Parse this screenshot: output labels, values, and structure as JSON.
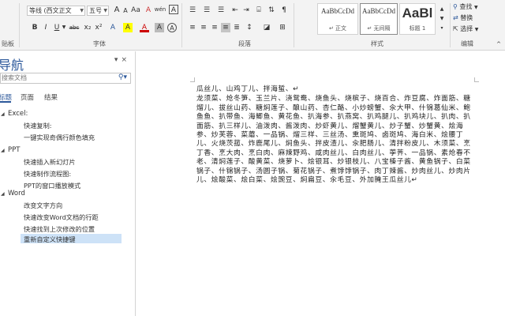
{
  "ribbon": {
    "clipboard_label": "贴板",
    "font_group_label": "字体",
    "paragraph_group_label": "段落",
    "styles_group_label": "样式",
    "editing_group_label": "编辑",
    "font_name": "等线 (西文正文",
    "font_size": "五号",
    "font_buttons": [
      "A",
      "A",
      "Aa",
      "A",
      "wén",
      "A"
    ],
    "format_buttons": [
      "B",
      "I",
      "U",
      "abc",
      "x₂",
      "x²"
    ],
    "effects_buttons": [
      "A",
      "A",
      "A",
      "A",
      "A"
    ],
    "styles": [
      {
        "sample": "AaBbCcDd",
        "name": "↵ 正文"
      },
      {
        "sample": "AaBbCcDd",
        "name": "↵ 无间隔"
      },
      {
        "sample": "AaBl",
        "name": "标题 1"
      }
    ],
    "editing": {
      "find": "查找",
      "replace": "替换",
      "select": "选择"
    }
  },
  "nav": {
    "title": "导航",
    "search_placeholder": "搜索文档",
    "tabs": [
      "标题",
      "页面",
      "结果"
    ],
    "tree": [
      {
        "head": "Excel:",
        "items": [
          "快速复制:",
          "一键实现奇偶行颜色填充"
        ]
      },
      {
        "head": "PPT",
        "items": [
          "快速插入新幻灯片",
          "快速制作流程图:",
          "PPT的窗口播放模式"
        ]
      },
      {
        "head": "Word",
        "items": [
          "改变文字方向",
          "快速改变Word文档的行距",
          "快速找到上次修改的位置",
          "重新自定义快捷键"
        ]
      }
    ]
  },
  "document": {
    "paragraph1": "瓜丝儿、山鸡丁儿、拌海蜇、↵",
    "paragraph2": "龙须菜、炝冬笋、玉兰片、浇鸳鸯、烧鱼头、烧槟子、烧百合、炸豆腐、炸面筋、糖熘儿、拔丝山药、糖焖莲子、酿山药、杏仁酪、小炒螃蟹、汆大甲、什锦葛仙米、鲍鱼鱼、扒带鱼、海鲫鱼、黄花鱼、扒海参、扒燕窝、扒鸡腿儿、扒鸡块儿、扒肉、扒面筋、扒三样儿、油泼肉、酱泼肉、炒虾黄儿、熘蟹黄儿、炒子蟹、炒蟹黄、烩海参、炒芙蓉、菜蘑、一品锅、熘三样、三丝汤、熏斑鸠、卤斑鸠、海白米、烩腰丁儿、火烧茨菰、炸鹿尾儿、焖鱼头、拌皮渣儿、汆肥肠儿、清拌粉皮儿、木须菜、烹丁香、烹大肉、烹白肉、麻辣野鸡、咸肉丝儿、白肉丝儿、荸荠、一品锅、素炝春不老、清焖莲子、酸黄菜、烧萝卜、烩银耳、炒银枝儿、八宝榛子酱、黄鱼锅子、白菜锅子、什锦锅子、汤圆子锅、菊花锅子、煮饽饽锅子、肉丁辣酱、炒肉丝儿、炒肉片儿、烩酸菜、烩白菜、烩豌豆、焖扁豆、汆毛豆、外加腌王瓜丝儿↵"
  }
}
